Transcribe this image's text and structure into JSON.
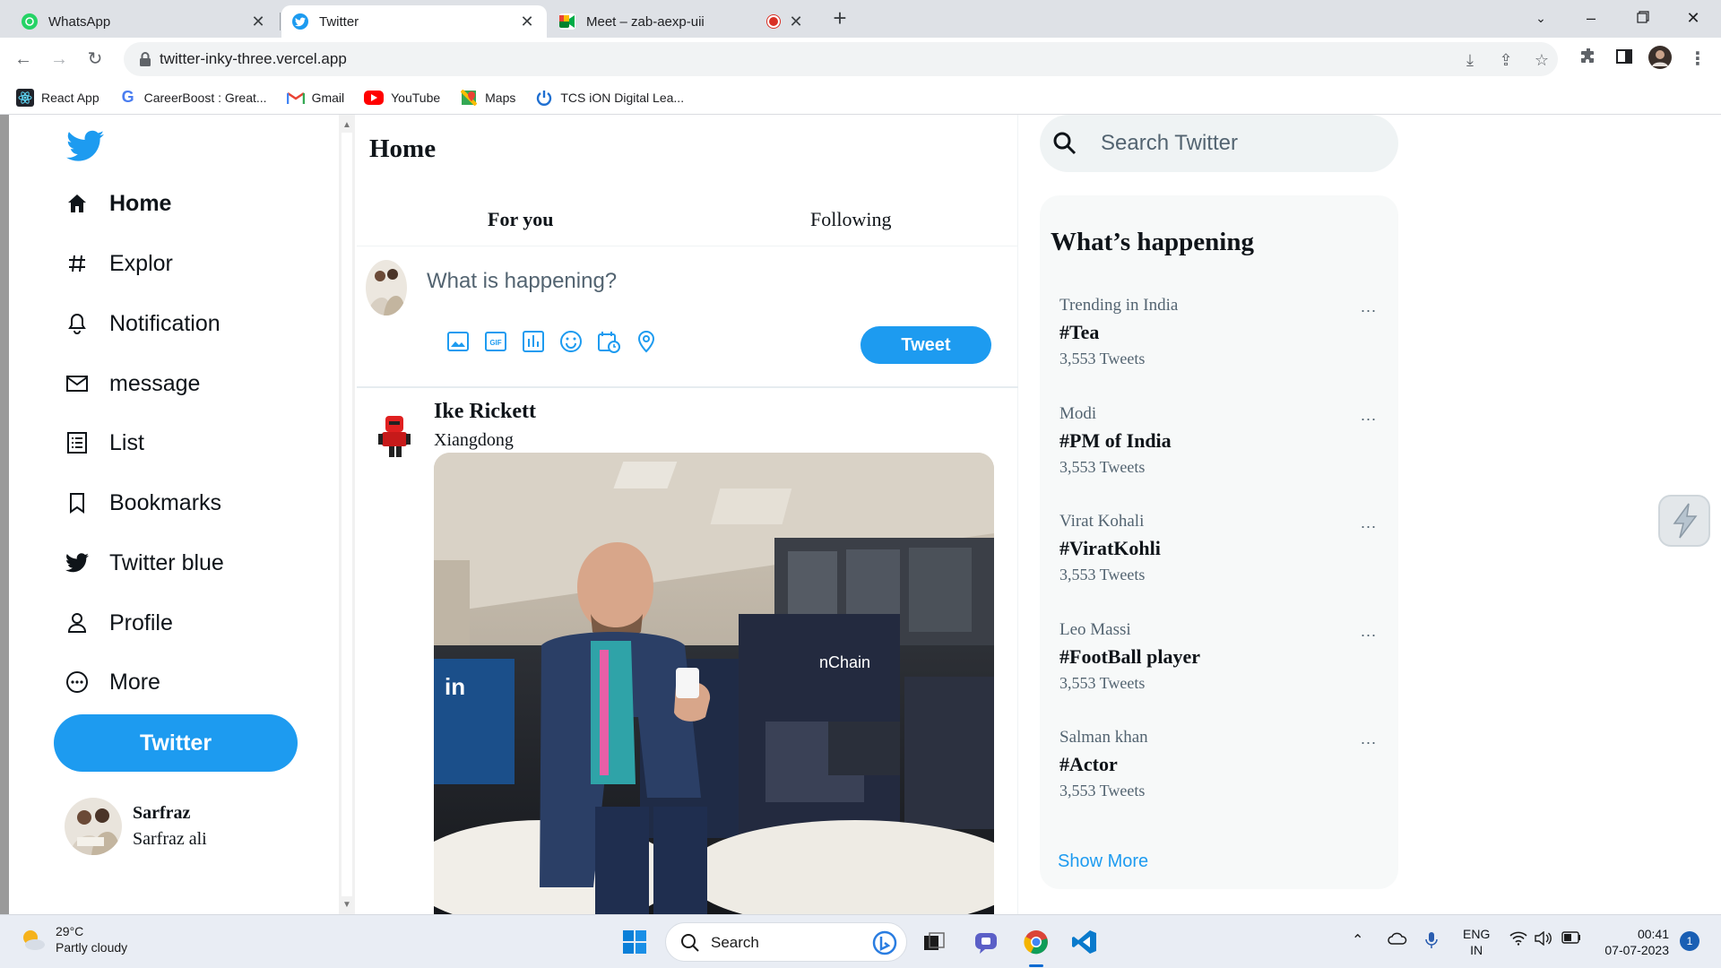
{
  "browser": {
    "tabs": [
      {
        "title": "WhatsApp",
        "active": false
      },
      {
        "title": "Twitter",
        "active": true
      },
      {
        "title": "Meet – zab-aexp-uii",
        "active": false
      }
    ],
    "url": "twitter-inky-three.vercel.app",
    "bookmarks": [
      {
        "label": "React App",
        "icon": "react-icon"
      },
      {
        "label": "CareerBoost : Great...",
        "icon": "careerboost-icon"
      },
      {
        "label": "Gmail",
        "icon": "gmail-icon"
      },
      {
        "label": "YouTube",
        "icon": "youtube-icon"
      },
      {
        "label": "Maps",
        "icon": "maps-icon"
      },
      {
        "label": "TCS iON Digital Lea...",
        "icon": "tcs-icon"
      }
    ]
  },
  "sidebar": {
    "nav": [
      {
        "label": "Home",
        "icon": "home-icon"
      },
      {
        "label": "Explor",
        "icon": "hashtag-icon"
      },
      {
        "label": "Notification",
        "icon": "bell-icon"
      },
      {
        "label": "message",
        "icon": "mail-icon"
      },
      {
        "label": "List",
        "icon": "list-icon"
      },
      {
        "label": "Bookmarks",
        "icon": "bookmark-icon"
      },
      {
        "label": "Twitter blue",
        "icon": "twitter-bird-icon"
      },
      {
        "label": "Profile",
        "icon": "person-icon"
      },
      {
        "label": "More",
        "icon": "more-circle-icon"
      }
    ],
    "tweet_button": "Twitter",
    "user": {
      "name": "Sarfraz",
      "handle": "Sarfraz ali"
    }
  },
  "feed": {
    "title": "Home",
    "tabs": [
      "For you",
      "Following"
    ],
    "composer": {
      "placeholder": "What is happening?",
      "tweet_label": "Tweet"
    },
    "post": {
      "name": "Ike Rickett",
      "handle": "Xiangdong"
    }
  },
  "right": {
    "search_placeholder": "Search Twitter",
    "trends_title": "What’s happening",
    "trends": [
      {
        "context": "Trending in India",
        "tag": "#Tea",
        "count": "3,553 Tweets"
      },
      {
        "context": "Modi",
        "tag": "#PM of India",
        "count": "3,553 Tweets"
      },
      {
        "context": "Virat Kohali",
        "tag": "#ViratKohli",
        "count": "3,553 Tweets"
      },
      {
        "context": "Leo Massi",
        "tag": "#FootBall player",
        "count": "3,553 Tweets"
      },
      {
        "context": "Salman khan",
        "tag": "#Actor",
        "count": "3,553 Tweets"
      }
    ],
    "more_symbol": "...",
    "show_more": "Show More"
  },
  "taskbar": {
    "weather_temp": "29°C",
    "weather_desc": "Partly cloudy",
    "search_label": "Search",
    "lang_top": "ENG",
    "lang_bottom": "IN",
    "time": "00:41",
    "date": "07-07-2023",
    "notifications": "1"
  },
  "colors": {
    "accent": "#1d9bf0",
    "text": "#0f1419",
    "muted": "#536471"
  }
}
